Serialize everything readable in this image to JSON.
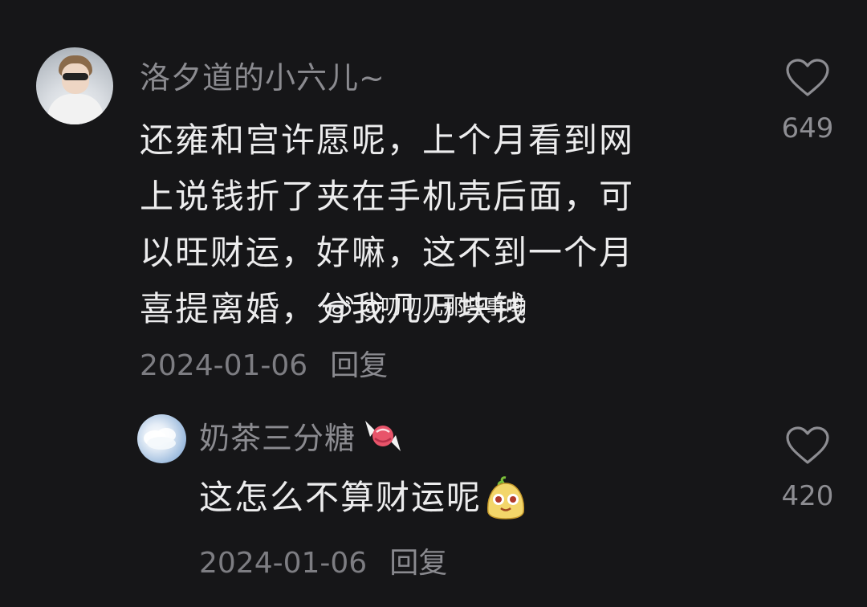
{
  "comments": [
    {
      "username": "洛夕道的小六儿~",
      "lines": [
        "还雍和宫许愿呢，上个月看到网",
        "上说钱折了夹在手机壳后面，可",
        "以旺财运，好嘛，这不到一个月",
        "喜提离婚，分我几万块钱"
      ],
      "date": "2024-01-06",
      "reply_label": "回复",
      "likes": "649",
      "icons": [
        "heart-outline-icon"
      ]
    },
    {
      "username": "奶茶三分糖",
      "text": "这怎么不算财运呢",
      "date": "2024-01-06",
      "reply_label": "回复",
      "likes": "420",
      "icons": [
        "candy-emoji-icon",
        "smiling-face-emoji-icon",
        "heart-outline-icon"
      ]
    }
  ],
  "watermark": {
    "text": "@叨叨儿那些事嘞"
  },
  "colors": {
    "background": "#161618",
    "text_primary": "#ececed",
    "text_secondary": "#8b8b90"
  }
}
